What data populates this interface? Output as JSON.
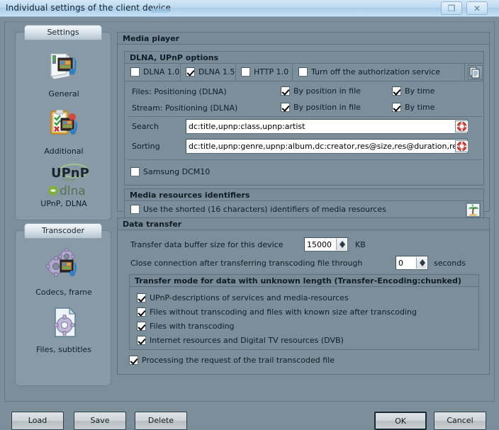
{
  "titlebar": {
    "title": "Individual settings of the client device",
    "restore_glyph": "❐",
    "close_glyph": "✕"
  },
  "sidebar": {
    "groups": [
      {
        "header": "Settings",
        "items": [
          {
            "label": "General",
            "icon": "media-folder-icon"
          },
          {
            "label": "Additional",
            "icon": "clipboard-media-icon"
          },
          {
            "label": "UPnP, DLNA",
            "icon": "upnp-dlna-logo-icon"
          }
        ]
      },
      {
        "header": "Transcoder",
        "items": [
          {
            "label": "Codecs, frame",
            "icon": "gears-media-icon"
          },
          {
            "label": "Files, subtitles",
            "icon": "file-gear-icon"
          }
        ]
      }
    ]
  },
  "main": {
    "media_player": {
      "title": "Media player",
      "dlna_upnp": {
        "title": "DLNA, UPnP options",
        "checkboxes": [
          {
            "label": "DLNA 1.0",
            "checked": false
          },
          {
            "label": "DLNA 1.5",
            "checked": true
          },
          {
            "label": "HTTP 1.0",
            "checked": false
          },
          {
            "label": "Turn off the authorization service",
            "checked": false
          }
        ],
        "copy_icon": "copy-settings-icon",
        "rows": [
          {
            "label": "Files: Positioning (DLNA)",
            "by_position": {
              "label": "By position in file",
              "checked": true
            },
            "by_time": {
              "label": "By time",
              "checked": true
            }
          },
          {
            "label": "Stream: Positioning (DLNA)",
            "by_position": {
              "label": "By position in file",
              "checked": true
            },
            "by_time": {
              "label": "By time",
              "checked": true
            }
          }
        ],
        "search": {
          "label": "Search",
          "value": "dc:title,upnp:class,upnp:artist",
          "icon": "lifebuoy-help-icon"
        },
        "sorting": {
          "label": "Sorting",
          "value": "dc:title,upnp:genre,upnp:album,dc:creator,res@size,res@duration,res@bitrate,d",
          "icon": "lifebuoy-help-icon"
        },
        "samsung": {
          "label": "Samsung DCM10",
          "checked": false
        }
      },
      "media_resources": {
        "title": "Media resources identifiers",
        "shorted_ids": {
          "label": "Use the shorted (16 characters) identifiers of media resources",
          "checked": false
        },
        "icon": "palm-tree-icon"
      }
    },
    "data_transfer": {
      "title": "Data transfer",
      "buffer": {
        "label": "Transfer data buffer size for this device",
        "value": "15000",
        "unit": "KB"
      },
      "close_conn": {
        "label": "Close connection after transferring transcoding file through",
        "value": "0",
        "unit": "seconds"
      },
      "chunked": {
        "title": "Transfer mode for data with unknown length (Transfer-Encoding:chunked)",
        "items": [
          {
            "label": "UPnP-descriptions of services and media-resources",
            "checked": true
          },
          {
            "label": "Files without transcoding and files with known size after transcoding",
            "checked": true
          },
          {
            "label": "Files with transcoding",
            "checked": true
          },
          {
            "label": "Internet resources and Digital TV resources (DVB)",
            "checked": true
          }
        ]
      },
      "trail": {
        "label": "Processing the request of the trail transcoded file",
        "checked": true
      }
    }
  },
  "footer": {
    "load": "Load",
    "save": "Save",
    "delete": "Delete",
    "ok": "OK",
    "cancel": "Cancel"
  },
  "colors": {
    "window_bg": "#7b8e9a",
    "titlebar": "#bcd9f0",
    "text": "#101d26",
    "input_bg": "#ffffff",
    "group_border": "#5f727f"
  }
}
